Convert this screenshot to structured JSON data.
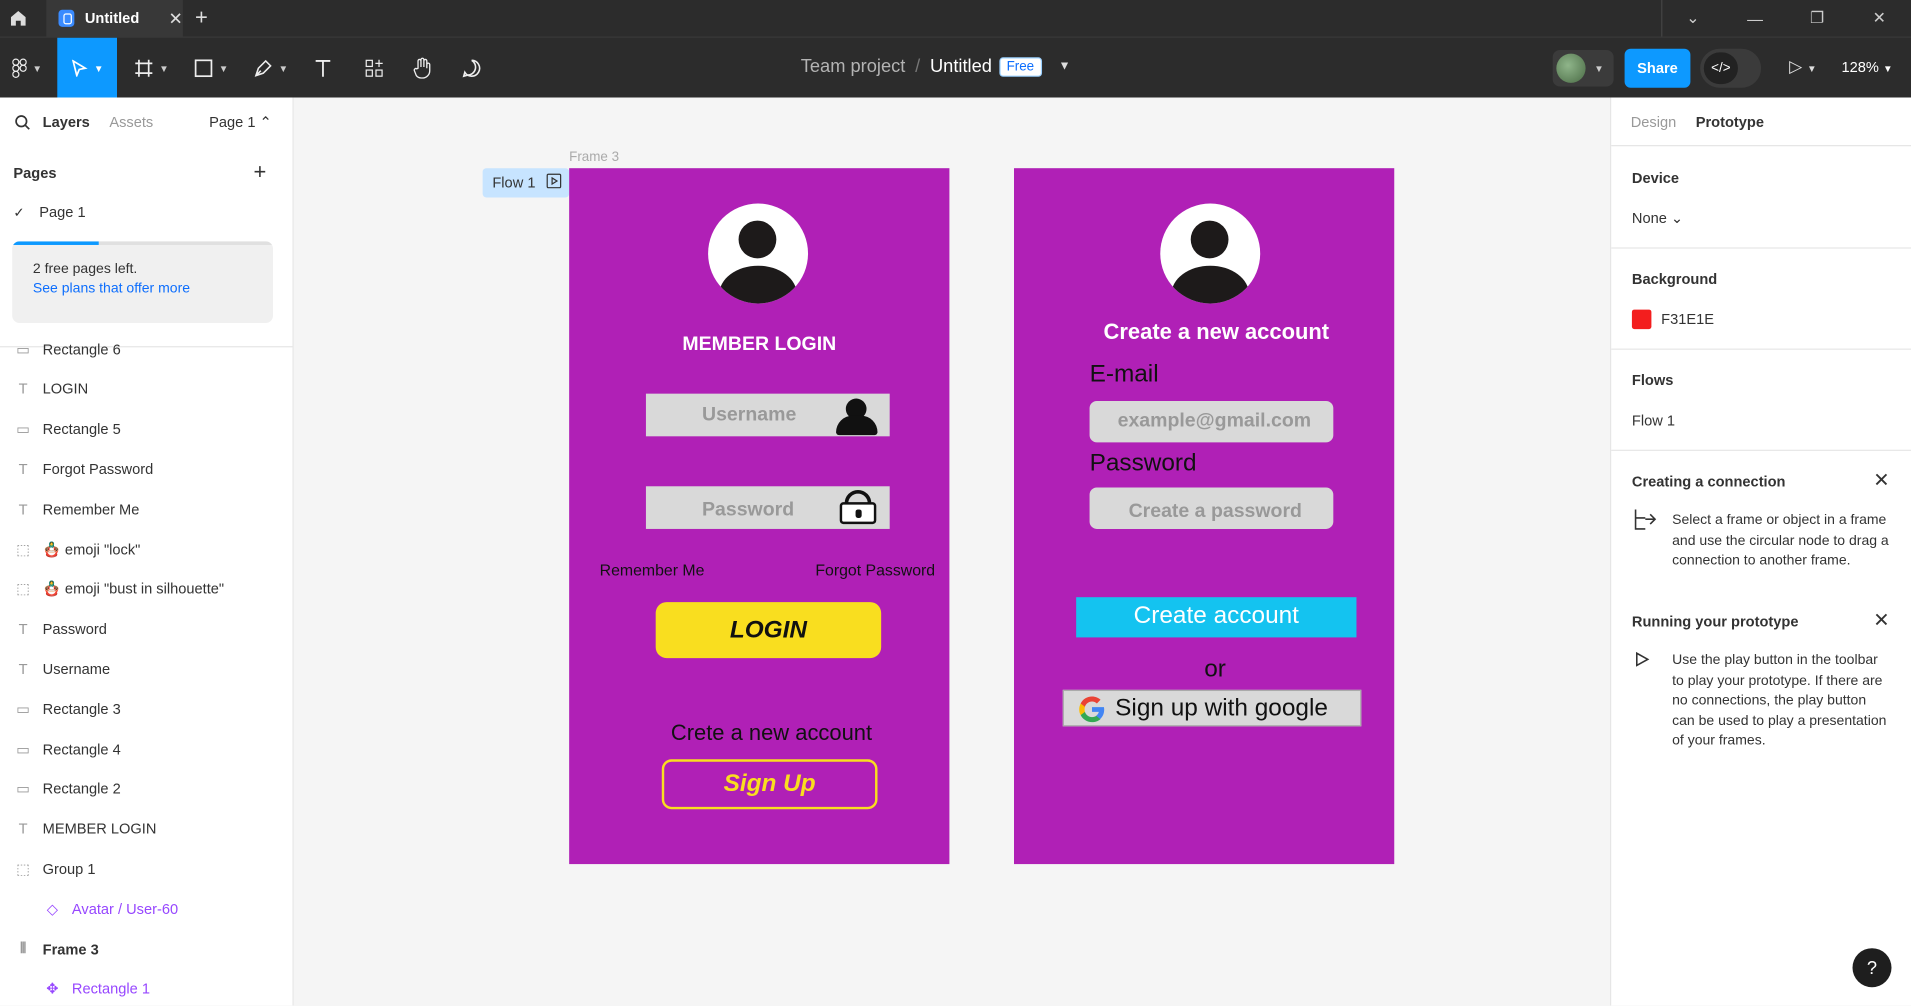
{
  "tab": {
    "title": "Untitled",
    "close": "✕",
    "new": "+"
  },
  "window": {
    "collapse": "⌄",
    "minimize": "—",
    "restore": "❐",
    "close": "✕"
  },
  "toolbar": {
    "tools": [
      "move-tool",
      "frame-tool",
      "shape-tool",
      "pen-tool",
      "text-tool",
      "resources-tool",
      "hand-tool",
      "comment-tool"
    ],
    "project": "Team project",
    "separator": "/",
    "file_name": "Untitled",
    "plan_badge": "Free",
    "share_label": "Share",
    "zoom": "128%"
  },
  "left_panel": {
    "tab_layers": "Layers",
    "tab_assets": "Assets",
    "page_selector": "Page 1 ⌃",
    "pages_header": "Pages",
    "add_page": "+",
    "current_page": "Page 1",
    "upsell_line1": "2 free pages left.",
    "upsell_line2": "See plans that offer more",
    "free_pages_used_fraction": 0.33,
    "layers": [
      {
        "name": "Rectangle 6",
        "icon": "rectangle-icon"
      },
      {
        "name": "LOGIN",
        "icon": "text-icon"
      },
      {
        "name": "Rectangle 5",
        "icon": "rectangle-icon"
      },
      {
        "name": "Forgot Password",
        "icon": "text-icon"
      },
      {
        "name": "Remember Me",
        "icon": "text-icon"
      },
      {
        "name": "🪆 emoji \"lock\"",
        "icon": "group-icon"
      },
      {
        "name": "🪆 emoji \"bust in silhouette\"",
        "icon": "group-icon"
      },
      {
        "name": "Password",
        "icon": "text-icon"
      },
      {
        "name": "Username",
        "icon": "text-icon"
      },
      {
        "name": "Rectangle 3",
        "icon": "rectangle-icon"
      },
      {
        "name": "Rectangle 4",
        "icon": "rectangle-icon"
      },
      {
        "name": "Rectangle 2",
        "icon": "rectangle-icon"
      },
      {
        "name": "MEMBER LOGIN",
        "icon": "text-icon"
      },
      {
        "name": "Group 1",
        "icon": "group-icon"
      },
      {
        "name": "Avatar / User-60",
        "icon": "component-instance-icon"
      },
      {
        "name": "Frame 3",
        "icon": "frame-icon"
      },
      {
        "name": "Rectangle 1",
        "icon": "component-icon"
      }
    ]
  },
  "canvas": {
    "frame_label": "Frame 3",
    "flow_tag": "Flow 1",
    "login_frame": {
      "title": "MEMBER LOGIN",
      "username_placeholder": "Username",
      "password_placeholder": "Password",
      "remember_me": "Remember Me",
      "forgot_password": "Forgot Password",
      "login_button": "LOGIN",
      "create_prompt": "Crete a new account",
      "signup_button": "Sign Up"
    },
    "signup_frame": {
      "title": "Create a new account",
      "email_label": "E-mail",
      "email_placeholder": "example@gmail.com",
      "password_label": "Password",
      "password_placeholder": "Create a password",
      "create_button": "Create account",
      "or": "or",
      "google_button": "Sign up with google"
    },
    "colors": {
      "frame_bg": "#B020B6",
      "login_yellow": "#F9DE1F",
      "create_cyan": "#14C3F0"
    }
  },
  "right_panel": {
    "tab_design": "Design",
    "tab_prototype": "Prototype",
    "device_header": "Device",
    "device_value": "None ⌄",
    "background_header": "Background",
    "background_value": "F31E1E",
    "background_color": "#F31E1E",
    "flows_header": "Flows",
    "flow_item": "Flow 1",
    "conn_header": "Creating a connection",
    "conn_text": "Select a frame or object in a frame and use the circular node to drag a connection to another frame.",
    "run_header": "Running your prototype",
    "run_text": "Use the play button in the toolbar to play your prototype. If there are no connections, the play button can be used to play a presentation of your frames.",
    "help": "?"
  }
}
